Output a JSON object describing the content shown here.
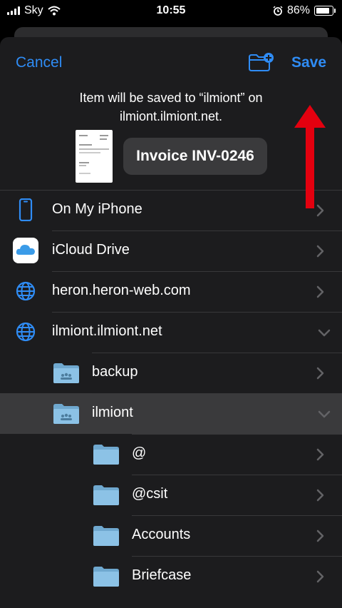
{
  "status": {
    "carrier": "Sky",
    "time": "10:55",
    "battery": "86%",
    "battery_level": 0.86
  },
  "header": {
    "cancel_label": "Cancel",
    "save_label": "Save"
  },
  "info": {
    "line1": "Item will be saved to “ilmiont” on",
    "line2": "ilmiont.ilmiont.net."
  },
  "file": {
    "name": "Invoice INV-0246"
  },
  "locations": [
    {
      "label": "On My iPhone",
      "icon": "phone-icon",
      "chevron": "right"
    },
    {
      "label": "iCloud Drive",
      "icon": "icloud-icon",
      "chevron": "right"
    },
    {
      "label": "heron.heron-web.com",
      "icon": "globe-icon",
      "chevron": "right"
    },
    {
      "label": "ilmiont.ilmiont.net",
      "icon": "globe-icon",
      "chevron": "down"
    },
    {
      "label": "backup",
      "icon": "shared-folder-icon",
      "chevron": "right"
    },
    {
      "label": "ilmiont",
      "icon": "shared-folder-icon",
      "chevron": "down",
      "selected": true
    },
    {
      "label": "@",
      "icon": "folder-icon",
      "chevron": "right"
    },
    {
      "label": "@csit",
      "icon": "folder-icon",
      "chevron": "right"
    },
    {
      "label": "Accounts",
      "icon": "folder-icon",
      "chevron": "right"
    },
    {
      "label": "Briefcase",
      "icon": "folder-icon",
      "chevron": "right"
    }
  ],
  "colors": {
    "accent": "#2f8cf5",
    "annotation": "#e3000f",
    "folder": "#7db9e0"
  }
}
